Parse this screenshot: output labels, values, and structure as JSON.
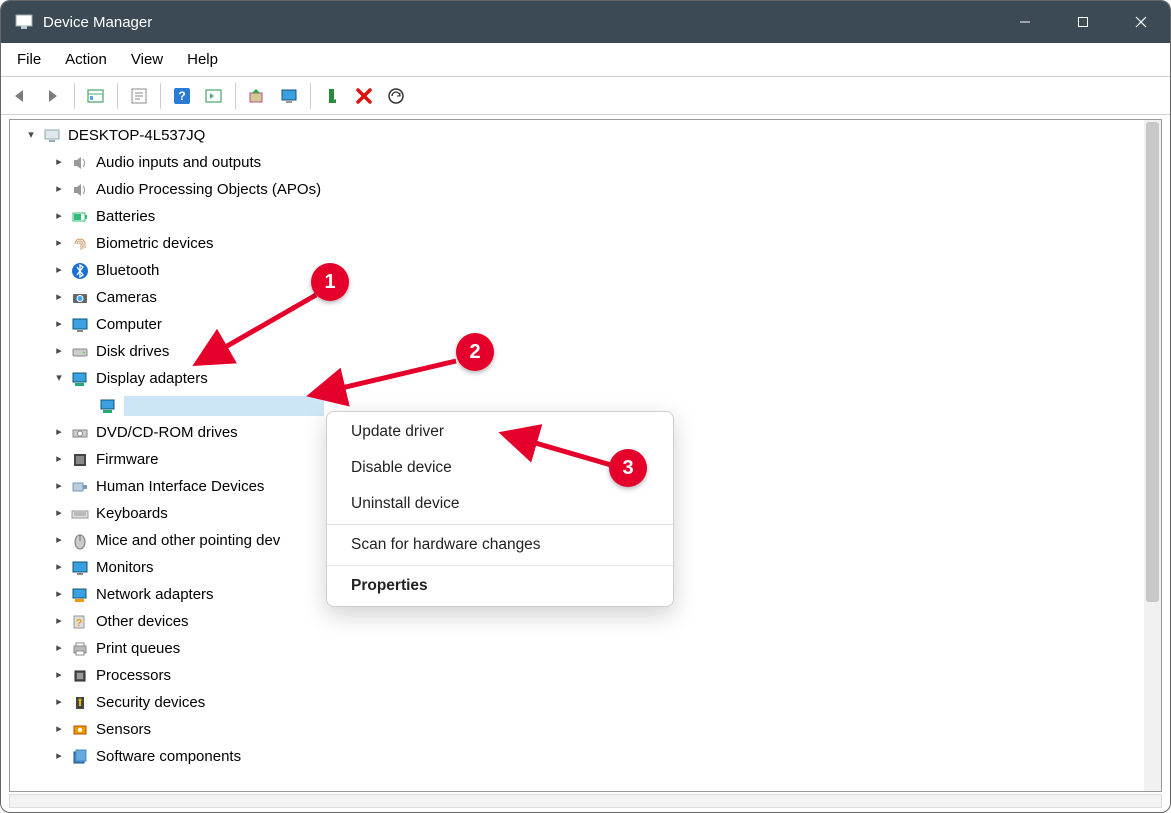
{
  "window": {
    "title": "Device Manager"
  },
  "menubar": {
    "file": "File",
    "action": "Action",
    "view": "View",
    "help": "Help"
  },
  "toolbar_icons": {
    "back": "back-icon",
    "forward": "forward-icon",
    "show_hidden": "show-hidden-icon",
    "properties": "properties-icon",
    "help": "help-icon",
    "resource": "resource-icon",
    "update": "update-driver-icon",
    "enable": "enable-device-icon",
    "uninstall": "uninstall-icon",
    "remove": "remove-icon",
    "scan": "scan-hardware-icon"
  },
  "tree": {
    "root": {
      "label": "DESKTOP-4L537JQ",
      "expanded": true
    },
    "items": [
      {
        "label": "Audio inputs and outputs",
        "icon": "speaker-icon",
        "expanded": false
      },
      {
        "label": "Audio Processing Objects (APOs)",
        "icon": "speaker-icon",
        "expanded": false
      },
      {
        "label": "Batteries",
        "icon": "battery-icon",
        "expanded": false
      },
      {
        "label": "Biometric devices",
        "icon": "fingerprint-icon",
        "expanded": false
      },
      {
        "label": "Bluetooth",
        "icon": "bluetooth-icon",
        "expanded": false
      },
      {
        "label": "Cameras",
        "icon": "camera-icon",
        "expanded": false
      },
      {
        "label": "Computer",
        "icon": "monitor-icon",
        "expanded": false
      },
      {
        "label": "Disk drives",
        "icon": "disk-icon",
        "expanded": false
      },
      {
        "label": "Display adapters",
        "icon": "display-adapter-icon",
        "expanded": true,
        "children": [
          {
            "label": "",
            "icon": "display-adapter-icon",
            "selected": true
          }
        ]
      },
      {
        "label": "DVD/CD-ROM drives",
        "icon": "optical-drive-icon",
        "expanded": false
      },
      {
        "label": "Firmware",
        "icon": "firmware-icon",
        "expanded": false
      },
      {
        "label": "Human Interface Devices",
        "icon": "hid-icon",
        "expanded": false
      },
      {
        "label": "Keyboards",
        "icon": "keyboard-icon",
        "expanded": false
      },
      {
        "label": "Mice and other pointing dev",
        "icon": "mouse-icon",
        "expanded": false
      },
      {
        "label": "Monitors",
        "icon": "monitor-icon",
        "expanded": false
      },
      {
        "label": "Network adapters",
        "icon": "network-icon",
        "expanded": false
      },
      {
        "label": "Other devices",
        "icon": "unknown-device-icon",
        "expanded": false
      },
      {
        "label": "Print queues",
        "icon": "printer-icon",
        "expanded": false
      },
      {
        "label": "Processors",
        "icon": "cpu-icon",
        "expanded": false
      },
      {
        "label": "Security devices",
        "icon": "security-icon",
        "expanded": false
      },
      {
        "label": "Sensors",
        "icon": "sensor-icon",
        "expanded": false
      },
      {
        "label": "Software components",
        "icon": "software-icon",
        "expanded": false
      }
    ]
  },
  "context_menu": {
    "update_driver": "Update driver",
    "disable_device": "Disable device",
    "uninstall_device": "Uninstall device",
    "scan_hardware": "Scan for hardware changes",
    "properties": "Properties"
  },
  "annotations": {
    "badge1": "1",
    "badge2": "2",
    "badge3": "3",
    "color": "#e4002b"
  }
}
